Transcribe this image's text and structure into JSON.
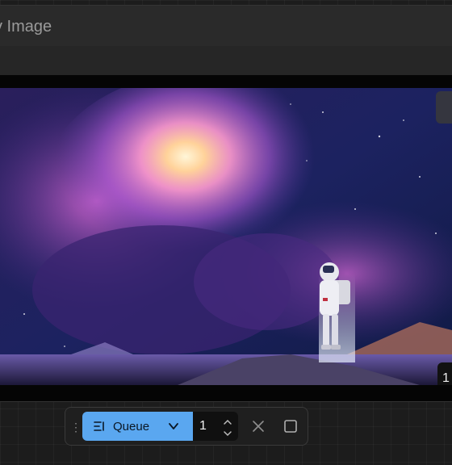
{
  "node": {
    "title": "v Image"
  },
  "preview": {
    "badge_text": "1"
  },
  "toolbar": {
    "queue_label": "Queue",
    "batch_count": "1",
    "drag_handle": "⋮",
    "queue_icon": "queue-list-icon",
    "dropdown_icon": "chevron-down-icon",
    "cancel_icon": "close-icon",
    "stop_icon": "stop-square-icon",
    "accent_color": "#5aa7f0"
  }
}
